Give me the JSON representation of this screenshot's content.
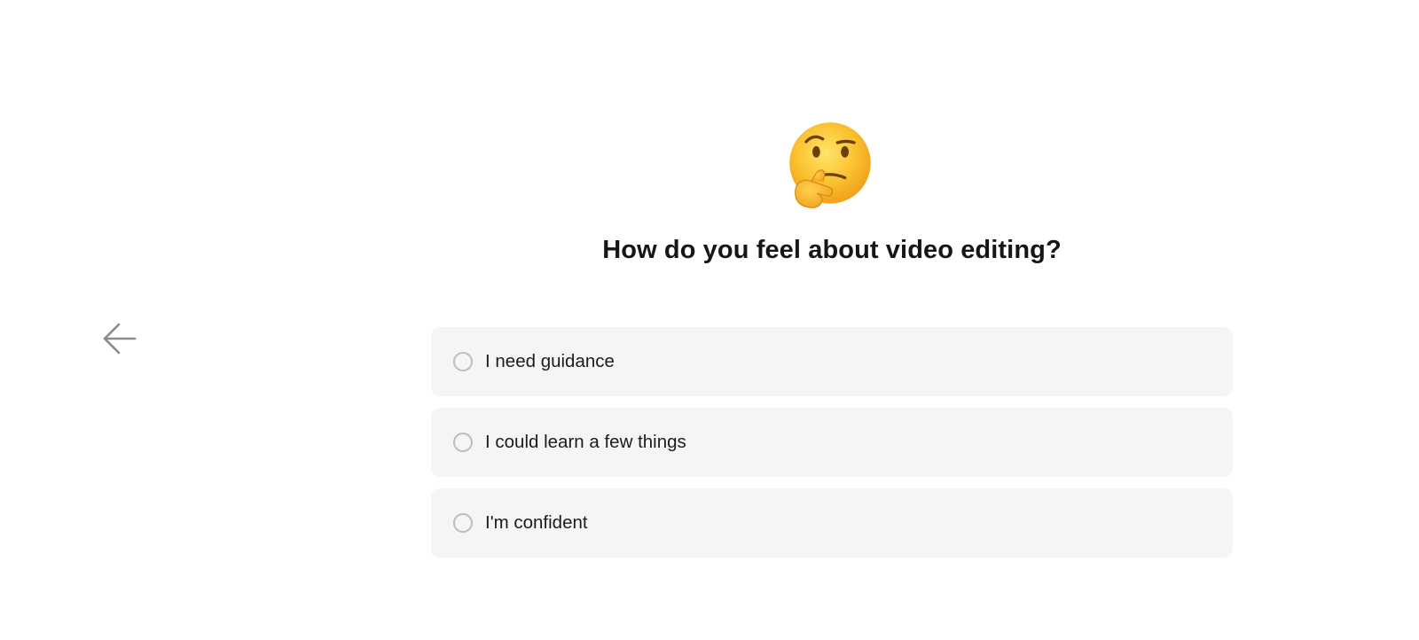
{
  "back": {
    "icon": "arrow-left-icon"
  },
  "header": {
    "emoji_icon": "thinking-face-icon"
  },
  "question": {
    "title": "How do you feel about video editing?"
  },
  "options": [
    {
      "label": "I need guidance",
      "selected": false
    },
    {
      "label": "I could learn a few things",
      "selected": false
    },
    {
      "label": "I'm confident",
      "selected": false
    }
  ],
  "colors": {
    "option_background": "#f5f5f5",
    "radio_border": "#bdbdbd",
    "back_arrow": "#8c8c8c",
    "text": "#161616"
  }
}
